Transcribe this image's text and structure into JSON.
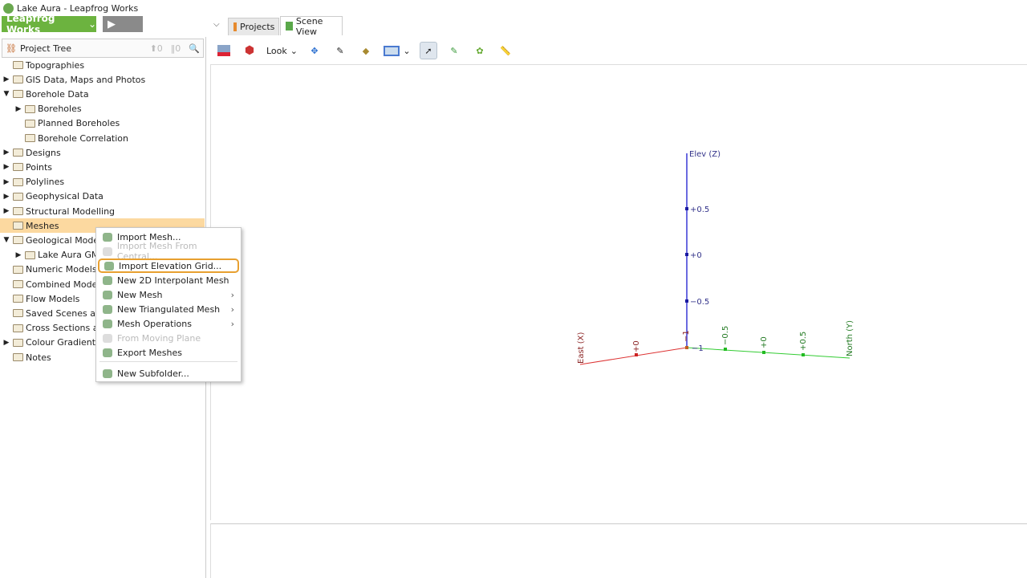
{
  "window": {
    "title": "Lake Aura - Leapfrog Works"
  },
  "app_button": "Leapfrog Works",
  "tabs": [
    {
      "label": "Projects"
    },
    {
      "label": "Scene View"
    }
  ],
  "project_tree": {
    "title": "Project Tree",
    "up_count": "0",
    "bar_count": "0",
    "items": [
      {
        "label": "Topographies",
        "arrow": "",
        "level": 0
      },
      {
        "label": "GIS Data, Maps and Photos",
        "arrow": "▶",
        "level": 0
      },
      {
        "label": "Borehole Data",
        "arrow": "▼",
        "level": 0
      },
      {
        "label": "Boreholes",
        "arrow": "▶",
        "level": 1
      },
      {
        "label": "Planned Boreholes",
        "arrow": "",
        "level": 1
      },
      {
        "label": "Borehole Correlation",
        "arrow": "",
        "level": 1
      },
      {
        "label": "Designs",
        "arrow": "▶",
        "level": 0
      },
      {
        "label": "Points",
        "arrow": "▶",
        "level": 0
      },
      {
        "label": "Polylines",
        "arrow": "▶",
        "level": 0
      },
      {
        "label": "Geophysical Data",
        "arrow": "▶",
        "level": 0
      },
      {
        "label": "Structural Modelling",
        "arrow": "▶",
        "level": 0
      },
      {
        "label": "Meshes",
        "arrow": "",
        "level": 0,
        "selected": true
      },
      {
        "label": "Geological Models",
        "arrow": "▼",
        "level": 0
      },
      {
        "label": "Lake Aura GM",
        "arrow": "▶",
        "level": 1
      },
      {
        "label": "Numeric Models",
        "arrow": "",
        "level": 0
      },
      {
        "label": "Combined Models",
        "arrow": "",
        "level": 0
      },
      {
        "label": "Flow Models",
        "arrow": "",
        "level": 0
      },
      {
        "label": "Saved Scenes and",
        "arrow": "",
        "level": 0
      },
      {
        "label": "Cross Sections and",
        "arrow": "",
        "level": 0
      },
      {
        "label": "Colour Gradients",
        "arrow": "▶",
        "level": 0
      },
      {
        "label": "Notes",
        "arrow": "",
        "level": 0
      }
    ]
  },
  "toolbar": {
    "look_label": "Look"
  },
  "context_menu": {
    "items": [
      {
        "label": "Import Mesh...",
        "enabled": true
      },
      {
        "label": "Import Mesh From Central...",
        "enabled": false
      },
      {
        "label": "Import Elevation Grid...",
        "enabled": true,
        "highlighted": true
      },
      {
        "label": "New 2D Interpolant Mesh",
        "enabled": true
      },
      {
        "label": "New Mesh",
        "enabled": true,
        "submenu": true
      },
      {
        "label": "New Triangulated Mesh",
        "enabled": true,
        "submenu": true
      },
      {
        "label": "Mesh Operations",
        "enabled": true,
        "submenu": true
      },
      {
        "label": "From Moving Plane",
        "enabled": false
      },
      {
        "label": "Export Meshes",
        "enabled": true
      },
      {
        "label": "New Subfolder...",
        "enabled": true
      }
    ]
  },
  "scene": {
    "z_axis": {
      "label": "Elev (Z)",
      "ticks": [
        "+0.5",
        "+0",
        "−0.5",
        "−1"
      ],
      "color": "#3333cc"
    },
    "x_axis": {
      "label": "East (X)",
      "ticks": [
        "+0",
        "−1"
      ],
      "color": "#dd3333"
    },
    "y_axis": {
      "label": "North (Y)",
      "ticks": [
        "−0.5",
        "+0",
        "+0.5"
      ],
      "color": "#33cc33"
    }
  }
}
